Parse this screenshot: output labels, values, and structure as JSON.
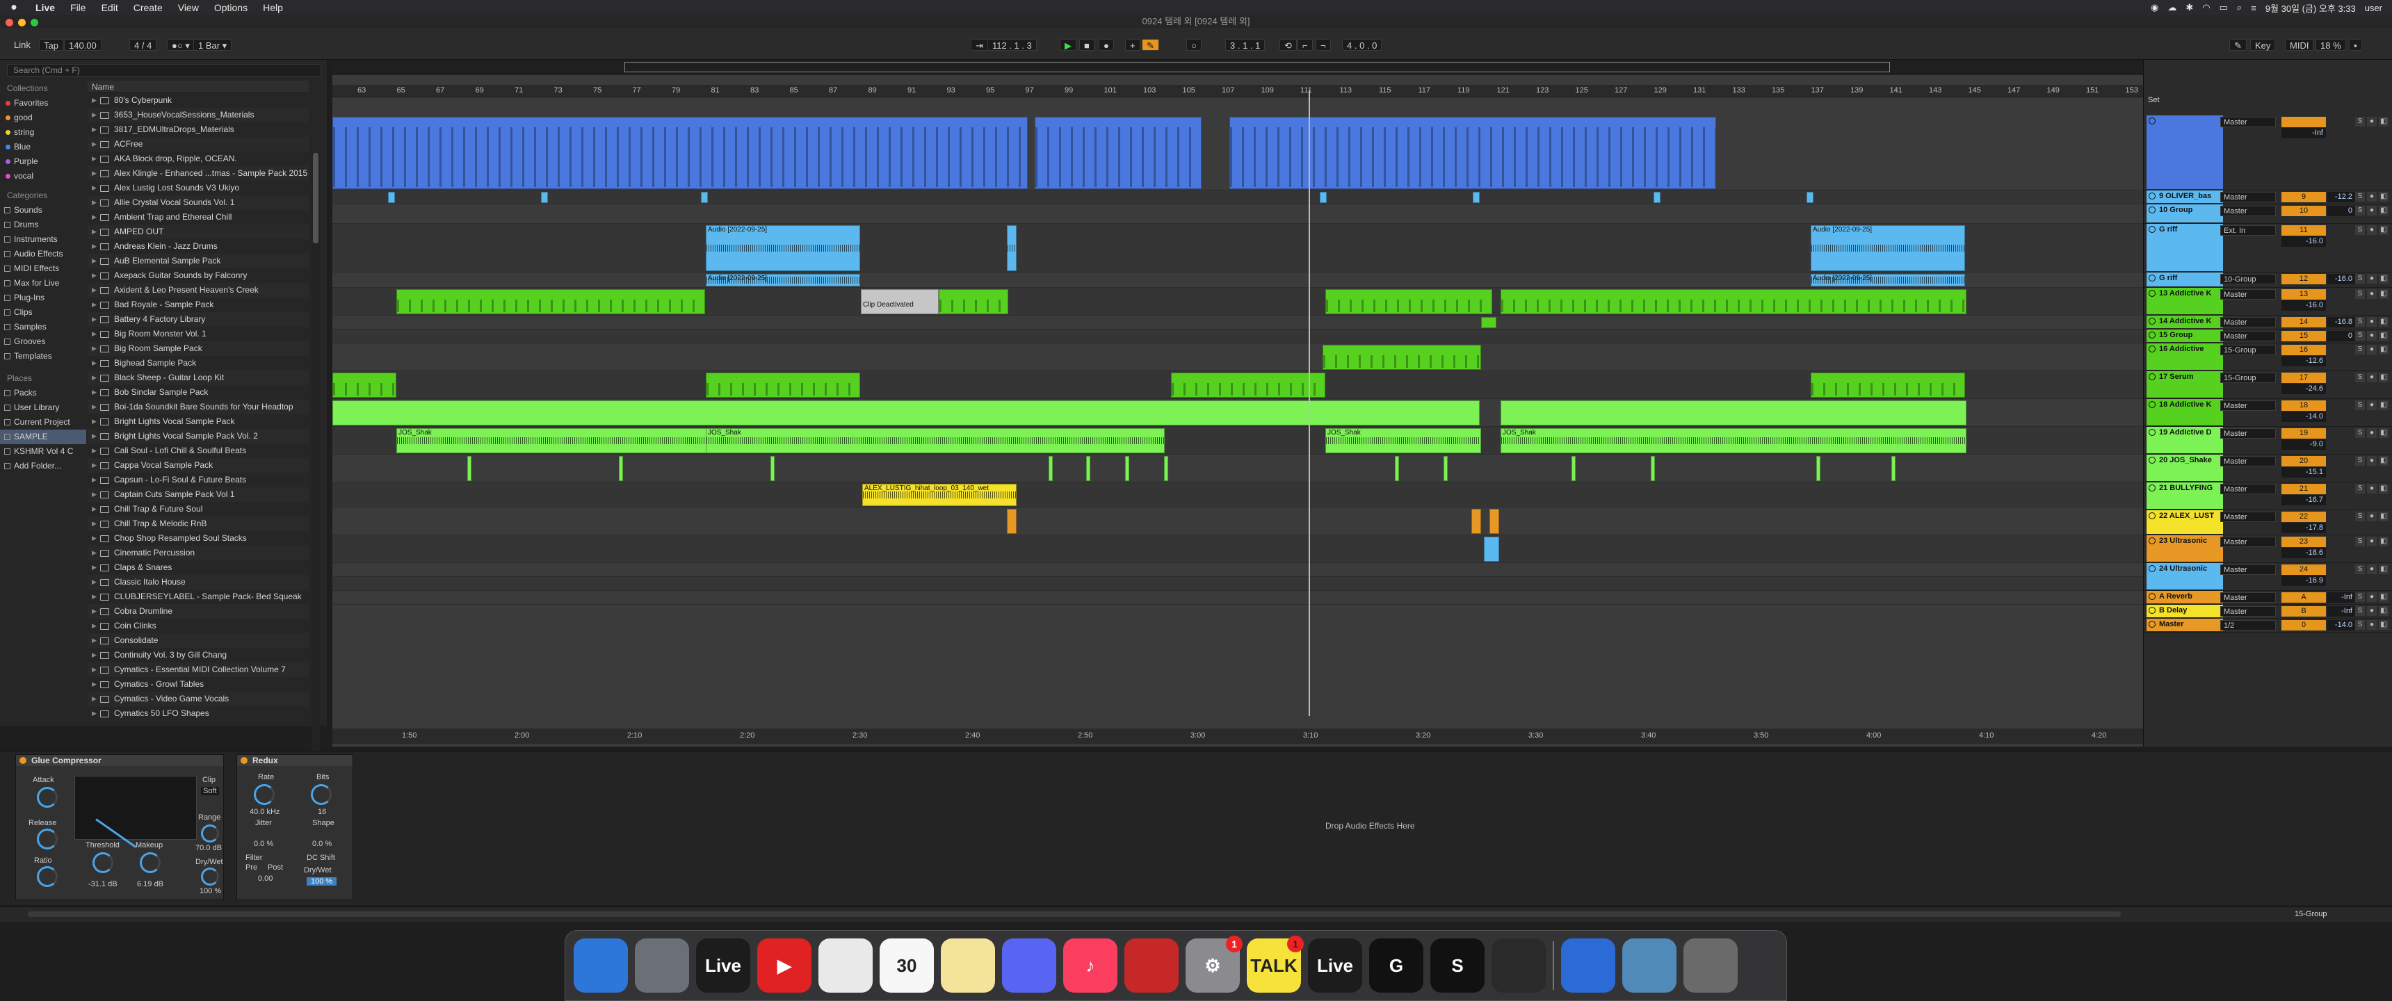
{
  "menubar": {
    "apple": "",
    "app": "Live",
    "items": [
      "File",
      "Edit",
      "Create",
      "View",
      "Options",
      "Help"
    ],
    "clock": "9월 30일 (금) 오후 3:33",
    "user": "user"
  },
  "window": {
    "title": "0924 템레 외  [0924 템레 외]"
  },
  "control": {
    "link": "Link",
    "tap": "Tap",
    "tempo": "140.00",
    "signature": "4 / 4",
    "metronome": "●○ ▾",
    "quant": "1 Bar ▾",
    "position": "112 .  1 .  3",
    "loop_start": "3 .  1 .  1",
    "loop_len": "4 .  0 .  0",
    "key": "Key",
    "midi": "MIDI",
    "cpu": "18 %"
  },
  "browser": {
    "search_placeholder": "Search (Cmd + F)",
    "name_header": "Name",
    "collections_label": "Collections",
    "collections": [
      {
        "label": "Favorites",
        "color": "#e2443a"
      },
      {
        "label": "good",
        "color": "#f0952a"
      },
      {
        "label": "string",
        "color": "#f0d22a"
      },
      {
        "label": "Blue",
        "color": "#3c8de8"
      },
      {
        "label": "Purple",
        "color": "#a263dc"
      },
      {
        "label": "vocal",
        "color": "#e04ed2"
      }
    ],
    "categories_label": "Categories",
    "categories": [
      "Sounds",
      "Drums",
      "Instruments",
      "Audio Effects",
      "MIDI Effects",
      "Max for Live",
      "Plug-Ins",
      "Clips",
      "Samples",
      "Grooves",
      "Templates"
    ],
    "places_label": "Places",
    "places": [
      "Packs",
      "User Library",
      "Current Project",
      "SAMPLE",
      "KSHMR Vol 4 C",
      "Add Folder..."
    ],
    "files": [
      "80's Cyberpunk",
      "3653_HouseVocalSessions_Materials",
      "3817_EDMUltraDrops_Materials",
      "ACFree",
      "AKA Block drop, Ripple, OCEAN.",
      "Alex Klingle - Enhanced ...tmas - Sample Pack 2015",
      "Alex Lustig Lost Sounds V3 Ukiyo",
      "Allie Crystal Vocal Sounds Vol. 1",
      "Ambient Trap and Ethereal Chill",
      "AMPED OUT",
      "Andreas Klein - Jazz Drums",
      "AuB Elemental Sample Pack",
      "Axepack Guitar Sounds by Falconry",
      "Axident & Leo Present Heaven's Creek",
      "Bad Royale - Sample Pack",
      "Battery 4 Factory Library",
      "Big Room Monster Vol. 1",
      "Big Room Sample Pack",
      "Bighead Sample Pack",
      "Black Sheep - Guitar Loop Kit",
      "Bob Sinclar Sample Pack",
      "Boi-1da Soundkit Bare Sounds for Your Headtop",
      "Bright Lights Vocal Sample Pack",
      "Bright Lights Vocal Sample Pack Vol. 2",
      "Cali Soul - Lofi Chill & Soulful Beats",
      "Cappa Vocal Sample Pack",
      "Capsun - Lo-Fi Soul & Future Beats",
      "Captain Cuts Sample Pack Vol 1",
      "Chill Trap & Future Soul",
      "Chill Trap & Melodic RnB",
      "Chop Shop Resampled Soul Stacks",
      "Cinematic Percussion",
      "Claps & Snares",
      "Classic Italo House",
      "CLUBJERSEYLABEL - Sample Pack- Bed Squeak",
      "Cobra Drumline",
      "Coin Clinks",
      "Consolidate",
      "Continuity Vol. 3 by Gill Chang",
      "Cymatics - Essential MIDI Collection Volume 7",
      "Cymatics - Growl Tables",
      "Cymatics - Video Game Vocals",
      "Cymatics 50 LFO Shapes"
    ]
  },
  "arrange": {
    "bars": [
      "63",
      "65",
      "67",
      "69",
      "71",
      "73",
      "75",
      "77",
      "79",
      "81",
      "83",
      "85",
      "87",
      "89",
      "91",
      "93",
      "95",
      "97",
      "99",
      "101",
      "103",
      "105",
      "107",
      "109",
      "111",
      "113",
      "115",
      "117",
      "119",
      "121",
      "123",
      "125",
      "127",
      "129",
      "131",
      "133",
      "135",
      "137",
      "139",
      "141",
      "143",
      "145",
      "147",
      "149",
      "151",
      "153"
    ],
    "times": [
      "1:50",
      "2:00",
      "2:10",
      "2:20",
      "2:30",
      "2:40",
      "2:50",
      "3:00",
      "3:10",
      "3:20",
      "3:30",
      "3:40",
      "3:50",
      "4:00",
      "4:10",
      "4:20"
    ],
    "clip_audio": "Audio [2022-09-25]",
    "clip_deact": "Clip Deactivated",
    "clip_jos": "JOS_Shak",
    "clip_alex": "ALEX_LUSTIG_hihat_loop_03_140_wet",
    "marker": "2"
  },
  "mixer": {
    "set": "Set",
    "tracks": [
      {
        "name": "",
        "color": "#4a78de",
        "route": "Master",
        "num": "",
        "vol": "-Inf"
      },
      {
        "name": "9 OLIVER_bas",
        "color": "#5cb9f0",
        "route": "Master",
        "num": "9",
        "vol": "-12.2"
      },
      {
        "name": "10 Group",
        "color": "#5cb9f0",
        "route": "Master",
        "num": "10",
        "vol": "0"
      },
      {
        "name": "G riff",
        "color": "#5cb9f0",
        "route": "Ext. In",
        "num": "11",
        "vol": "-16.0"
      },
      {
        "name": "G riff",
        "color": "#5cb9f0",
        "route": "10-Group",
        "num": "12",
        "vol": "-16.0"
      },
      {
        "name": "13 Addictive K",
        "color": "#56d11f",
        "route": "Master",
        "num": "13",
        "vol": "-16.0"
      },
      {
        "name": "14 Addictive K",
        "color": "#56d11f",
        "route": "Master",
        "num": "14",
        "vol": "-16.8"
      },
      {
        "name": "15 Group",
        "color": "#56d11f",
        "route": "Master",
        "num": "15",
        "vol": "0"
      },
      {
        "name": "16 Addictive",
        "color": "#56d11f",
        "route": "15-Group",
        "num": "16",
        "vol": "-12.6"
      },
      {
        "name": "17 Serum",
        "color": "#56d11f",
        "route": "15-Group",
        "num": "17",
        "vol": "-24.6"
      },
      {
        "name": "18 Addictive K",
        "color": "#56d11f",
        "route": "Master",
        "num": "18",
        "vol": "-14.0"
      },
      {
        "name": "19 Addictive D",
        "color": "#7cf255",
        "route": "Master",
        "num": "19",
        "vol": "-9.0"
      },
      {
        "name": "20 JOS_Shake",
        "color": "#7cf255",
        "route": "Master",
        "num": "20",
        "vol": "-15.1"
      },
      {
        "name": "21 BULLYFING",
        "color": "#7cf255",
        "route": "Master",
        "num": "21",
        "vol": "-16.7"
      },
      {
        "name": "22 ALEX_LUST",
        "color": "#f4e12a",
        "route": "Master",
        "num": "22",
        "vol": "-17.8"
      },
      {
        "name": "23 Ultrasonic",
        "color": "#e89824",
        "route": "Master",
        "num": "23",
        "vol": "-18.6"
      },
      {
        "name": "24 Ultrasonic",
        "color": "#5cb9f0",
        "route": "Master",
        "num": "24",
        "vol": "-16.9"
      },
      {
        "name": "A Reverb",
        "color": "#e89824",
        "route": "Master",
        "num": "A",
        "vol": "-Inf"
      },
      {
        "name": "B Delay",
        "color": "#f4e12a",
        "route": "Master",
        "num": "B",
        "vol": "-Inf"
      },
      {
        "name": "Master",
        "color": "#e89824",
        "route": "1/2",
        "num": "0",
        "vol": "-14.0"
      }
    ]
  },
  "devices": {
    "glue": {
      "title": "Glue Compressor",
      "attack": "Attack",
      "release": "Release",
      "ratio": "Ratio",
      "threshold": "Threshold",
      "threshold_val": "-31.1 dB",
      "makeup": "Makeup",
      "makeup_val": "6.19 dB",
      "clip": "Clip",
      "soft": "Soft",
      "range": "Range",
      "range_val": "70.0 dB",
      "drywet": "Dry/Wet",
      "drywet_val": "100 %"
    },
    "redux": {
      "title": "Redux",
      "rate": "Rate",
      "rate_val": "40.0 kHz",
      "bits": "Bits",
      "bits_val": "16",
      "jitter": "Jitter",
      "jitter_val": "0.0 %",
      "shape": "Shape",
      "shape_val": "0.0 %",
      "filter": "Filter",
      "pre": "Pre",
      "post": "Post",
      "filter_val": "0.00",
      "dc": "DC Shift",
      "drywet": "Dry/Wet",
      "drywet_val": "100 %"
    },
    "drop": "Drop Audio Effects Here"
  },
  "status": {
    "track": "15-Group"
  },
  "dock": [
    {
      "label": "",
      "color": "#2d77d9"
    },
    {
      "label": "",
      "color": "#6b6f78"
    },
    {
      "label": "Live",
      "color": "#1c1c1c"
    },
    {
      "label": "▶",
      "color": "#e02222"
    },
    {
      "label": "",
      "color": "#e9e9e9"
    },
    {
      "label": "30",
      "color": "#f7f7f7"
    },
    {
      "label": "",
      "color": "#f3e49a"
    },
    {
      "label": "",
      "color": "#5865f2"
    },
    {
      "label": "♪",
      "color": "#fb3d5f"
    },
    {
      "label": "",
      "color": "#c62828"
    },
    {
      "label": "⚙",
      "color": "#8a8a8f"
    },
    {
      "label": "TALK",
      "color": "#f7e23b"
    },
    {
      "label": "Live",
      "color": "#1c1c1c"
    },
    {
      "label": "G",
      "color": "#111111"
    },
    {
      "label": "S",
      "color": "#111111"
    },
    {
      "label": "",
      "color": "#2a2a2a"
    },
    {
      "label": "",
      "color": "#2a6bd6"
    },
    {
      "label": "",
      "color": "#4f8ab8"
    },
    {
      "label": "",
      "color": "#6a6a6a"
    }
  ]
}
